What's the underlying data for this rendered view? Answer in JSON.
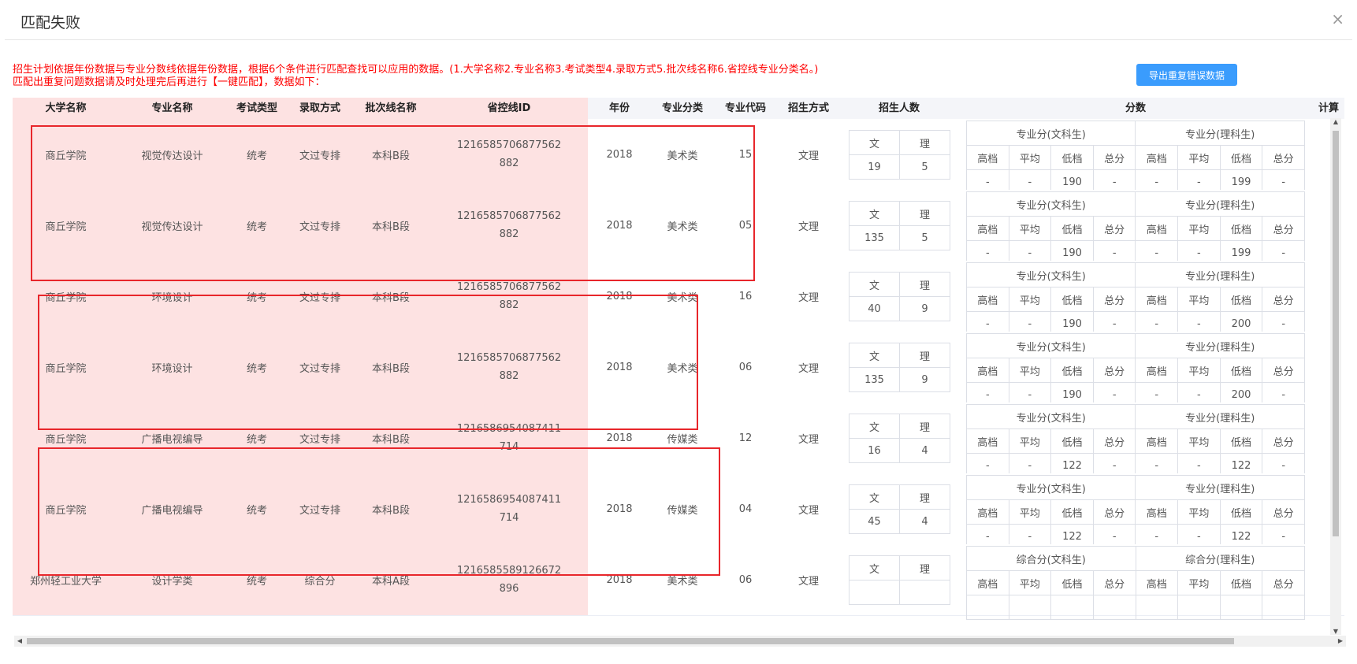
{
  "dialog": {
    "title": "匹配失败",
    "close": "×"
  },
  "notice": {
    "line1": "招生计划依据年份数据与专业分数线依据年份数据，根据6个条件进行匹配查找可以应用的数据。(1.大学名称2.专业名称3.考试类型4.录取方式5.批次线名称6.省控线专业分类名。)",
    "line2": "匹配出重复问题数据请及时处理完后再进行【一键匹配】，数据如下："
  },
  "export_button": "导出重复错误数据",
  "columns": {
    "university": "大学名称",
    "major": "专业名称",
    "exam_type": "考试类型",
    "admission": "录取方式",
    "batch": "批次线名称",
    "line_id": "省控线ID",
    "year": "年份",
    "category": "专业分类",
    "code": "专业代码",
    "method": "招生方式",
    "enroll": "招生人数",
    "score": "分数",
    "calc": "计算"
  },
  "enroll_labels": {
    "wen": "文",
    "li": "理"
  },
  "score_levels": [
    "高档",
    "平均",
    "低档",
    "总分"
  ],
  "rows": [
    {
      "university": "商丘学院",
      "major": "视觉传达设计",
      "exam_type": "统考",
      "admission": "文过专排",
      "batch": "本科B段",
      "line_id": "1216585706877562882",
      "year": "2018",
      "category": "美术类",
      "code": "15",
      "method": "文理",
      "enroll_wen": "19",
      "enroll_li": "5",
      "score_arts_title": "专业分(文科生)",
      "score_sci_title": "专业分(理科生)",
      "arts": [
        "-",
        "-",
        "190",
        "-"
      ],
      "sci": [
        "-",
        "-",
        "199",
        "-"
      ]
    },
    {
      "university": "商丘学院",
      "major": "视觉传达设计",
      "exam_type": "统考",
      "admission": "文过专排",
      "batch": "本科B段",
      "line_id": "1216585706877562882",
      "year": "2018",
      "category": "美术类",
      "code": "05",
      "method": "文理",
      "enroll_wen": "135",
      "enroll_li": "5",
      "score_arts_title": "专业分(文科生)",
      "score_sci_title": "专业分(理科生)",
      "arts": [
        "-",
        "-",
        "190",
        "-"
      ],
      "sci": [
        "-",
        "-",
        "199",
        "-"
      ]
    },
    {
      "university": "商丘学院",
      "major": "环境设计",
      "exam_type": "统考",
      "admission": "文过专排",
      "batch": "本科B段",
      "line_id": "1216585706877562882",
      "year": "2018",
      "category": "美术类",
      "code": "16",
      "method": "文理",
      "enroll_wen": "40",
      "enroll_li": "9",
      "score_arts_title": "专业分(文科生)",
      "score_sci_title": "专业分(理科生)",
      "arts": [
        "-",
        "-",
        "190",
        "-"
      ],
      "sci": [
        "-",
        "-",
        "200",
        "-"
      ]
    },
    {
      "university": "商丘学院",
      "major": "环境设计",
      "exam_type": "统考",
      "admission": "文过专排",
      "batch": "本科B段",
      "line_id": "1216585706877562882",
      "year": "2018",
      "category": "美术类",
      "code": "06",
      "method": "文理",
      "enroll_wen": "135",
      "enroll_li": "9",
      "score_arts_title": "专业分(文科生)",
      "score_sci_title": "专业分(理科生)",
      "arts": [
        "-",
        "-",
        "190",
        "-"
      ],
      "sci": [
        "-",
        "-",
        "200",
        "-"
      ]
    },
    {
      "university": "商丘学院",
      "major": "广播电视编导",
      "exam_type": "统考",
      "admission": "文过专排",
      "batch": "本科B段",
      "line_id": "1216586954087411714",
      "year": "2018",
      "category": "传媒类",
      "code": "12",
      "method": "文理",
      "enroll_wen": "16",
      "enroll_li": "4",
      "score_arts_title": "专业分(文科生)",
      "score_sci_title": "专业分(理科生)",
      "arts": [
        "-",
        "-",
        "122",
        "-"
      ],
      "sci": [
        "-",
        "-",
        "122",
        "-"
      ]
    },
    {
      "university": "商丘学院",
      "major": "广播电视编导",
      "exam_type": "统考",
      "admission": "文过专排",
      "batch": "本科B段",
      "line_id": "1216586954087411714",
      "year": "2018",
      "category": "传媒类",
      "code": "04",
      "method": "文理",
      "enroll_wen": "45",
      "enroll_li": "4",
      "score_arts_title": "专业分(文科生)",
      "score_sci_title": "专业分(理科生)",
      "arts": [
        "-",
        "-",
        "122",
        "-"
      ],
      "sci": [
        "-",
        "-",
        "122",
        "-"
      ]
    },
    {
      "university": "郑州轻工业大学",
      "major": "设计学类",
      "exam_type": "统考",
      "admission": "综合分",
      "batch": "本科A段",
      "line_id": "1216585589126672896",
      "year": "2018",
      "category": "美术类",
      "code": "06",
      "method": "文理",
      "enroll_wen": "",
      "enroll_li": "",
      "score_arts_title": "综合分(文科生)",
      "score_sci_title": "综合分(理科生)",
      "arts": [
        "",
        "",
        "",
        ""
      ],
      "sci": [
        "",
        "",
        "",
        ""
      ]
    }
  ],
  "scroll_arrows": {
    "up": "▲",
    "down": "▼",
    "left": "◀",
    "right": "▶"
  }
}
